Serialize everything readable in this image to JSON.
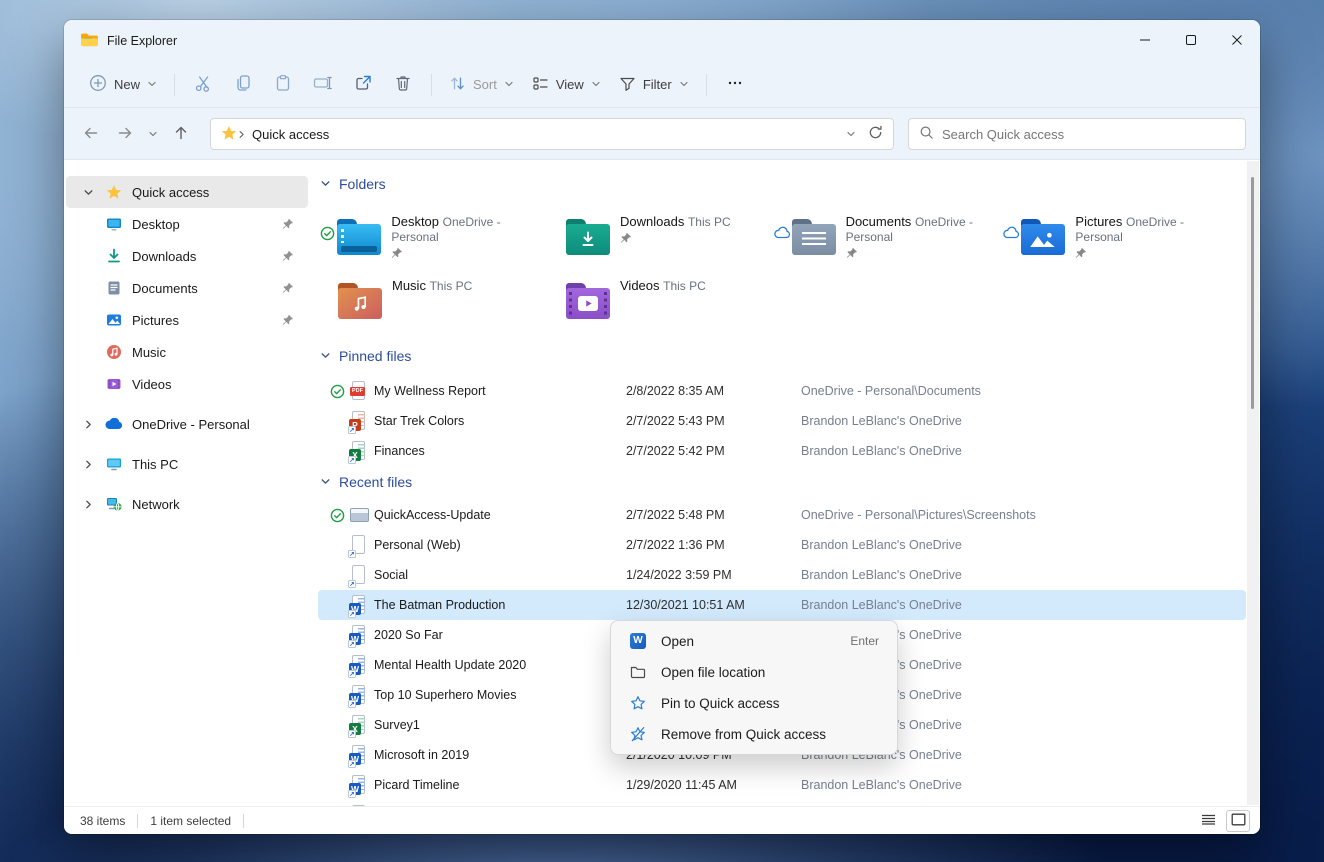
{
  "colors": {
    "accent": "#2a7fd4",
    "selection": "#d3eafd",
    "section_header": "#2b4d9c",
    "header_bg": "#edf3fa",
    "sync_green": "#1d9e46"
  },
  "titlebar": {
    "title": "File Explorer"
  },
  "toolbar": {
    "new": "New",
    "sort": "Sort",
    "view": "View",
    "filter": "Filter"
  },
  "address": {
    "crumb": "Quick access",
    "search_placeholder": "Search Quick access"
  },
  "sidebar": {
    "items": [
      {
        "icon": "star-icon",
        "chevron": "chevron-down-icon",
        "label": "Quick access",
        "selected": true
      },
      {
        "icon": "desktop-icon",
        "label": "Desktop",
        "pinned": true
      },
      {
        "icon": "downloads-icon",
        "label": "Downloads",
        "pinned": true
      },
      {
        "icon": "documents-icon",
        "label": "Documents",
        "pinned": true
      },
      {
        "icon": "pictures-icon",
        "label": "Pictures",
        "pinned": true
      },
      {
        "icon": "music-icon",
        "label": "Music"
      },
      {
        "icon": "videos-icon",
        "label": "Videos"
      },
      {
        "icon": "onedrive-icon",
        "chevron": "chevron-right-icon",
        "label": "OneDrive - Personal",
        "gap": true
      },
      {
        "icon": "thispc-icon",
        "chevron": "chevron-right-icon",
        "label": "This PC",
        "gap": true
      },
      {
        "icon": "network-icon",
        "chevron": "chevron-right-icon",
        "label": "Network",
        "gap": true
      }
    ]
  },
  "content": {
    "folders": {
      "label": "Folders",
      "tiles": [
        {
          "status": "synced-icon",
          "folder": "folder-desktop-icon",
          "name": "Desktop",
          "sublabel": "OneDrive - Personal",
          "pinned": true
        },
        {
          "status": "",
          "folder": "folder-downloads-icon",
          "name": "Downloads",
          "sublabel": "This PC",
          "pinned": true
        },
        {
          "status": "cloud-icon",
          "folder": "folder-documents-icon",
          "name": "Documents",
          "sublabel": "OneDrive - Personal",
          "pinned": true
        },
        {
          "status": "cloud-icon",
          "folder": "folder-pictures-icon",
          "name": "Pictures",
          "sublabel": "OneDrive - Personal",
          "pinned": true
        },
        {
          "status": "",
          "folder": "folder-music-icon",
          "name": "Music",
          "sublabel": "This PC",
          "pinned": false
        },
        {
          "status": "",
          "folder": "folder-videos-icon",
          "name": "Videos",
          "sublabel": "This PC",
          "pinned": false
        }
      ]
    },
    "pinned": {
      "label": "Pinned files",
      "rows": [
        {
          "status": "synced-icon",
          "icon": "pdf-file-icon",
          "name": "My Wellness Report",
          "date": "2/8/2022 8:35 AM",
          "location": "OneDrive - Personal\\Documents"
        },
        {
          "status": "",
          "icon": "ppt-file-icon",
          "name": "Star Trek Colors",
          "date": "2/7/2022 5:43 PM",
          "location": "Brandon LeBlanc's OneDrive"
        },
        {
          "status": "",
          "icon": "xls-file-icon",
          "name": "Finances",
          "date": "2/7/2022 5:42 PM",
          "location": "Brandon LeBlanc's OneDrive"
        }
      ]
    },
    "recent": {
      "label": "Recent files",
      "rows": [
        {
          "status": "synced-icon",
          "icon": "image-file-icon",
          "name": "QuickAccess-Update",
          "date": "2/7/2022 5:48 PM",
          "location": "OneDrive - Personal\\Pictures\\Screenshots"
        },
        {
          "status": "",
          "icon": "blank-file-icon",
          "name": "Personal (Web)",
          "date": "2/7/2022 1:36 PM",
          "location": "Brandon LeBlanc's OneDrive"
        },
        {
          "status": "",
          "icon": "blank-file-icon",
          "name": "Social",
          "date": "1/24/2022 3:59 PM",
          "location": "Brandon LeBlanc's OneDrive"
        },
        {
          "status": "",
          "icon": "word-file-icon",
          "name": "The Batman Production",
          "date": "12/30/2021 10:51 AM",
          "location": "Brandon LeBlanc's OneDrive",
          "selected": true
        },
        {
          "status": "",
          "icon": "word-file-icon",
          "name": "2020 So Far",
          "date": "",
          "location": "Brandon LeBlanc's OneDrive"
        },
        {
          "status": "",
          "icon": "word-file-icon",
          "name": "Mental Health Update 2020",
          "date": "",
          "location": "Brandon LeBlanc's OneDrive"
        },
        {
          "status": "",
          "icon": "word-file-icon",
          "name": "Top 10 Superhero Movies",
          "date": "",
          "location": "Brandon LeBlanc's OneDrive"
        },
        {
          "status": "",
          "icon": "xls-file-icon",
          "name": "Survey1",
          "date": "",
          "location": "Brandon LeBlanc's OneDrive"
        },
        {
          "status": "",
          "icon": "word-file-icon",
          "name": "Microsoft in 2019",
          "date": "2/1/2020 10:09 PM",
          "location": "Brandon LeBlanc's OneDrive"
        },
        {
          "status": "",
          "icon": "word-file-icon",
          "name": "Picard Timeline",
          "date": "1/29/2020 11:45 AM",
          "location": "Brandon LeBlanc's OneDrive"
        },
        {
          "status": "",
          "icon": "blank-file-icon",
          "name": "",
          "date": "",
          "location": ""
        }
      ]
    }
  },
  "context_menu": {
    "items": [
      {
        "icon": "word-logo-icon",
        "label": "Open",
        "shortcut": "Enter"
      },
      {
        "icon": "folder-open-icon",
        "label": "Open file location",
        "shortcut": ""
      },
      {
        "icon": "pin-star-icon",
        "label": "Pin to Quick access",
        "shortcut": ""
      },
      {
        "icon": "unpin-star-icon",
        "label": "Remove from Quick access",
        "shortcut": ""
      }
    ]
  },
  "statusbar": {
    "count": "38 items",
    "selected": "1 item selected"
  }
}
